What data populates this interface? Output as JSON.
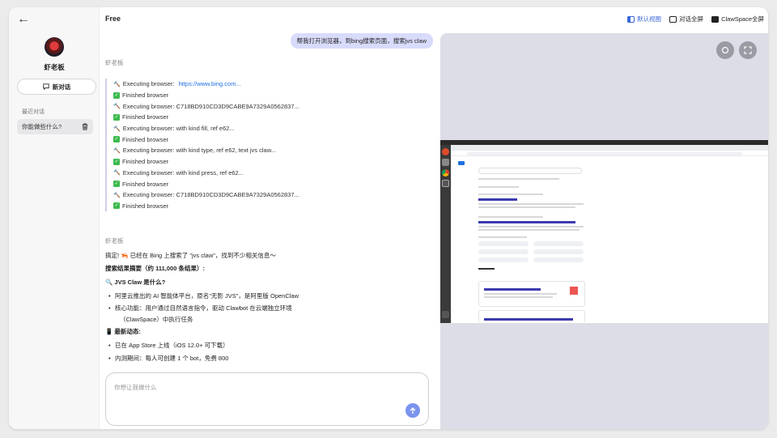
{
  "sidebar": {
    "back_icon": "arrow-left-icon",
    "user_name": "虾老板",
    "new_chat_label": "新对话",
    "recent_title": "最近对话",
    "recent_items": [
      {
        "label": "你能做些什么?"
      }
    ]
  },
  "chat": {
    "title": "Free",
    "user_message": "帮我打开浏览器，到bing搜索页面，搜索jvs claw",
    "bot_name": "虾老板",
    "log": [
      {
        "type": "exec",
        "text": "Executing browser: ",
        "link": "https://www.bing.com..."
      },
      {
        "type": "done",
        "text": "Finished browser"
      },
      {
        "type": "exec",
        "text": "Executing browser: C718BD910CD3D9CABE9A7329A0562837..."
      },
      {
        "type": "done",
        "text": "Finished browser"
      },
      {
        "type": "exec",
        "text": "Executing browser: with kind fill, ref e62..."
      },
      {
        "type": "done",
        "text": "Finished browser"
      },
      {
        "type": "exec",
        "text": "Executing browser: with kind type, ref e62, text jvs claw..."
      },
      {
        "type": "done",
        "text": "Finished browser"
      },
      {
        "type": "exec",
        "text": "Executing browser: with kind press, ref e62..."
      },
      {
        "type": "done",
        "text": "Finished browser"
      },
      {
        "type": "exec",
        "text": "Executing browser: C718BD910CD3D9CABE9A7329A0562837..."
      },
      {
        "type": "done",
        "text": "Finished browser"
      }
    ],
    "reply": {
      "intro": "搞定! 🦐 已经在 Bing 上搜索了 \"jvs claw\"，找到不少相关信息～",
      "summary": "搜索结果摘要（约 111,000 条结果）:",
      "what_heading": "🔍 JVS Claw 是什么?",
      "what_items": [
        "阿里云推出的 AI 智能体平台，原名\"无影 JVS\"，是阿里版 OpenClaw",
        "核心功能：用户通过自然语言指令，驱动 Clawbot 在云端独立环境"
      ],
      "what_item_cont": "（ClawSpace）中执行任务",
      "news_heading": "📱 最新动态:",
      "news_items": [
        "已在 App Store 上线（iOS 12.0+ 可下载）",
        "内测期间：每人可创建 1 个 bot，免费 800"
      ]
    },
    "input_placeholder": "你想让我做什么",
    "send_icon": "arrow-up-icon"
  },
  "view_modes": [
    {
      "label": "默认视图",
      "active": true
    },
    {
      "label": "对话全屏",
      "active": false
    },
    {
      "label": "ClawSpace全屏",
      "active": false
    }
  ],
  "colors": {
    "accent": "#3a67d8",
    "bubble": "#d9dbfb",
    "send": "#7b94ee",
    "check": "#3dba4e",
    "link": "#1f6fe0"
  }
}
